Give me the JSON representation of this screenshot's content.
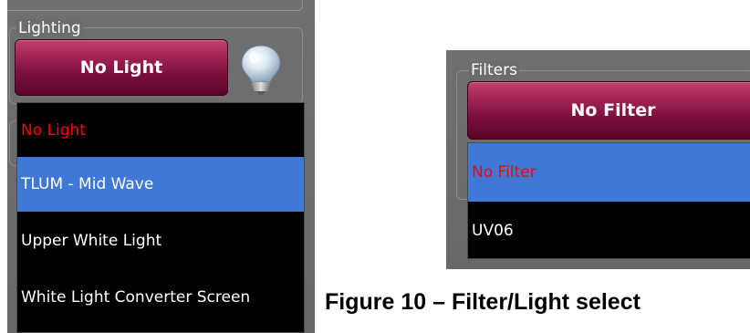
{
  "lighting": {
    "group_title": "Lighting",
    "button_label": "No Light",
    "bulb_icon": "light-bulb-icon",
    "options": [
      {
        "label": "No Light",
        "state": "current"
      },
      {
        "label": "TLUM - Mid Wave",
        "state": "highlighted"
      },
      {
        "label": "Upper White Light",
        "state": "normal"
      },
      {
        "label": "White Light Converter Screen",
        "state": "normal"
      }
    ]
  },
  "filters": {
    "group_title": "Filters",
    "button_label": "No Filter",
    "options": [
      {
        "label": "No Filter",
        "state": "current-highlighted"
      },
      {
        "label": "UV06",
        "state": "normal"
      }
    ]
  },
  "caption": "Figure 10 – Filter/Light select",
  "colors": {
    "panel": "#6a6c6e",
    "button": "#8a1848",
    "list_bg": "#000000",
    "highlight": "#3f78d6",
    "current_item": "#ff0000",
    "item_text": "#ffffff"
  }
}
